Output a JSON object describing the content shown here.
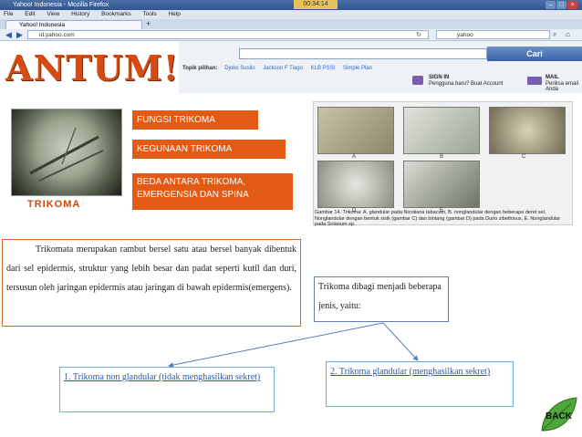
{
  "window": {
    "title": "Yahoo! Indonesia - Mozilla Firefox",
    "timer": "00:34:14"
  },
  "menu": [
    "File",
    "Edit",
    "View",
    "History",
    "Bookmarks",
    "Tools",
    "Help"
  ],
  "tab": {
    "label": "Yahoo! Indonesia"
  },
  "url": "id.yahoo.com",
  "search_engine": "yahoo",
  "yahoo": {
    "search_button": "Cari",
    "trending_label": "Topik pilihan:",
    "trending": [
      "Djoko Susilo",
      "Jackson F Tiago",
      "KLB PSSI",
      "Simple Plan"
    ],
    "signin": "SIGN IN",
    "signin_sub": "Pengguna baru? Buat Account",
    "mail": "MAIL",
    "mail_sub": "Periksa email Anda"
  },
  "slide": {
    "logo": "ANTUM!",
    "micro_label": "TRIKOMA",
    "buttons": [
      "FUNGSI TRIKOMA",
      "KEGUNAAN TRIKOMA",
      "BEDA ANTARA TRIKOMA, EMERGENSIA DAN SPINA"
    ],
    "figure_labels": [
      "A",
      "B",
      "C",
      "D",
      "E"
    ],
    "figure_caption": "Gambar 14. Trikoma: A. glandular pada Nicotiana tabacum, B. nonglandular dengan beberapa deret sel, Nonglandular dengan bentuk sisik (gambar C) dan bintang (gambar D) pada Durio zibethinus, E. Nonglandular pada Solanum sp.",
    "description": "Trikomata merupakan rambut bersel satu atau bersel banyak dibentuk dari sel epidermis, struktur yang lebih besar dan padat seperti kutil dan duri, tersusun oleh jaringan epidermis atau jaringan di bawah epidermis(emergens).",
    "division": "Trikoma dibagi menjadi beberapa jenis, yaitu:",
    "type1": "1. Trikoma non glandular (tidak menghasilkan sekret)",
    "type2": "2. Trikoma glandular (menghasilkan sekret)",
    "back": "BACK"
  }
}
